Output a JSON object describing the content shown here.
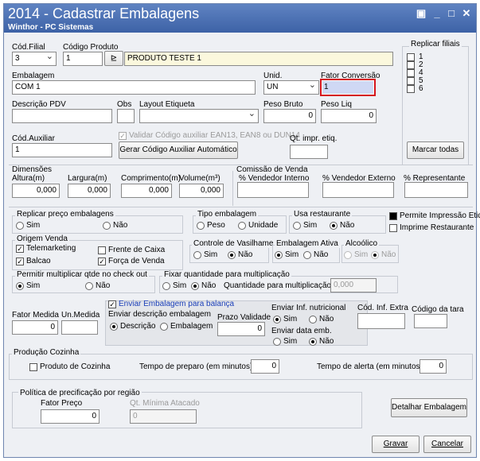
{
  "window": {
    "title": "2014 - Cadastrar Embalagens",
    "subtitle": "Winthor - PC Sistemas",
    "controls": [
      "▣",
      "_",
      "□",
      "✕"
    ]
  },
  "top": {
    "cod_filial_label": "Cód.Filial",
    "cod_filial_value": "3",
    "cod_produto_label": "Código Produto",
    "cod_produto_value": "1",
    "produto_desc": "PRODUTO TESTE 1",
    "search_btn": "⊵",
    "replicar_filiais_label": "Replicar filiais",
    "filiais": [
      "1",
      "2",
      "4",
      "5",
      "6"
    ],
    "marcar_todas": "Marcar todas"
  },
  "row2": {
    "embalagem_label": "Embalagem",
    "embalagem_value": "COM 1",
    "unid_label": "Unid.",
    "unid_value": "UN",
    "fator_label": "Fator Conversão",
    "fator_value": "1"
  },
  "row3": {
    "desc_pdv_label": "Descrição PDV",
    "obs_label": "Obs",
    "layout_label": "Layout Etiqueta",
    "peso_bruto_label": "Peso Bruto",
    "peso_bruto_value": "0",
    "peso_liq_label": "Peso Liq",
    "peso_liq_value": "0"
  },
  "row4": {
    "cod_aux_label": "Cód.Auxiliar",
    "cod_aux_value": "1",
    "validar_label": "Validar Código auxiliar EAN13, EAN8 ou DUN14",
    "gerar_btn": "Gerar Código Auxiliar Automático",
    "qt_impr_label": "Qt. impr. etiq."
  },
  "dimensoes": {
    "title": "Dimensões",
    "altura_label": "Altura(m)",
    "altura_value": "0,000",
    "largura_label": "Largura(m)",
    "largura_value": "0,000",
    "comp_label": "Comprimento(m)",
    "comp_value": "0,000",
    "volume_label": "Volume(m³)",
    "volume_value": "0,000"
  },
  "comissao": {
    "title": "Comissão de Venda",
    "interno": "% Vendedor Interno",
    "externo": "% Vendedor Externo",
    "representante": "% Representante"
  },
  "replicar_preco": {
    "title": "Replicar preço embalagens",
    "sim": "Sim",
    "nao": "Não"
  },
  "tipo_embalagem": {
    "title": "Tipo embalagem",
    "peso": "Peso",
    "unidade": "Unidade"
  },
  "usa_restaurante": {
    "title": "Usa restaurante",
    "sim": "Sim",
    "nao": "Não"
  },
  "impressao": {
    "permite": "Permite Impressão Etiqueta",
    "imprime": "Imprime Restaurante"
  },
  "origem_venda": {
    "title": "Origem Venda",
    "telemarketing": "Telemarketing",
    "balcao": "Balcao",
    "frente_caixa": "Frente de Caixa",
    "forca_venda": "Força de Venda"
  },
  "vasilhame": {
    "title": "Controle de Vasilhame",
    "sim": "Sim",
    "nao": "Não"
  },
  "embalagem_ativa": {
    "title": "Embalagem Ativa",
    "sim": "Sim",
    "nao": "Não"
  },
  "alcoolico": {
    "title": "Alcoólico",
    "sim": "Sim",
    "nao": "Não"
  },
  "multiplicar": {
    "title": "Permitir multiplicar qtde no check out",
    "sim": "Sim",
    "nao": "Não"
  },
  "fixar": {
    "title": "Fixar quantidade para multiplicação",
    "sim": "Sim",
    "nao": "Não",
    "qtd_label": "Quantidade para multiplicação:",
    "qtd_value": "0,000"
  },
  "balanca": {
    "enviar_label": "Enviar Embalagem para balança",
    "fator_medida_label": "Fator Medida",
    "fator_medida_value": "0",
    "un_medida_label": "Un.Medida",
    "enviar_desc_label": "Enviar descrição embalagem",
    "descricao": "Descrição",
    "embalagem": "Embalagem",
    "prazo_label": "Prazo Validade",
    "prazo_value": "0",
    "inf_nutri_label": "Enviar Inf. nutricional",
    "sim": "Sim",
    "nao": "Não",
    "data_emb_label": "Enviar data emb.",
    "cod_inf_extra_label": "Cód. Inf. Extra",
    "cod_tara_label": "Código da tara"
  },
  "producao": {
    "title": "Produção Cozinha",
    "produto_cozinha": "Produto de Cozinha",
    "preparo_label": "Tempo de preparo (em minutos):",
    "preparo_value": "0",
    "alerta_label": "Tempo de alerta (em minutos):",
    "alerta_value": "0"
  },
  "politica": {
    "title": "Política de precificação por região",
    "fator_preco_label": "Fator Preço",
    "fator_preco_value": "0",
    "qt_min_label": "Qt. Mínima Atacado",
    "qt_min_value": "0",
    "detalhar_btn": "Detalhar Embalagem"
  },
  "footer": {
    "gravar": "Gravar",
    "cancelar": "Cancelar"
  }
}
